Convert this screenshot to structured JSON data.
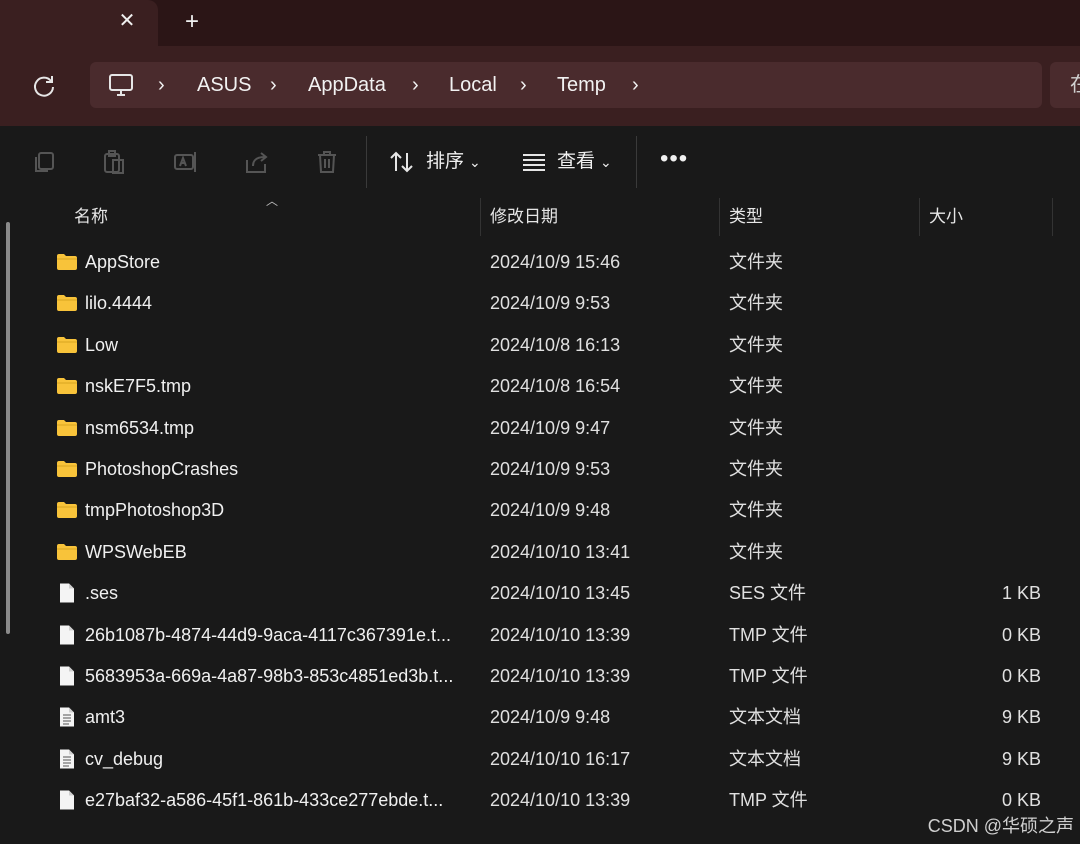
{
  "tabbar": {
    "close_glyph": "✕",
    "new_tab_glyph": "+"
  },
  "address": {
    "crumbs": [
      "ASUS",
      "AppData",
      "Local",
      "Temp"
    ],
    "separator": "›",
    "search_partial": "在"
  },
  "toolbar": {
    "sort_label": "排序",
    "view_label": "查看",
    "more_glyph": "•••",
    "dropdown_glyph": "⌄"
  },
  "columns": {
    "name": "名称",
    "modified": "修改日期",
    "type": "类型",
    "size": "大小"
  },
  "files": [
    {
      "name": "AppStore",
      "date": "2024/10/9 15:46",
      "type": "文件夹",
      "size": "",
      "kind": "folder"
    },
    {
      "name": "lilo.4444",
      "date": "2024/10/9 9:53",
      "type": "文件夹",
      "size": "",
      "kind": "folder"
    },
    {
      "name": "Low",
      "date": "2024/10/8 16:13",
      "type": "文件夹",
      "size": "",
      "kind": "folder"
    },
    {
      "name": "nskE7F5.tmp",
      "date": "2024/10/8 16:54",
      "type": "文件夹",
      "size": "",
      "kind": "folder"
    },
    {
      "name": "nsm6534.tmp",
      "date": "2024/10/9 9:47",
      "type": "文件夹",
      "size": "",
      "kind": "folder"
    },
    {
      "name": "PhotoshopCrashes",
      "date": "2024/10/9 9:53",
      "type": "文件夹",
      "size": "",
      "kind": "folder"
    },
    {
      "name": "tmpPhotoshop3D",
      "date": "2024/10/9 9:48",
      "type": "文件夹",
      "size": "",
      "kind": "folder"
    },
    {
      "name": "WPSWebEB",
      "date": "2024/10/10 13:41",
      "type": "文件夹",
      "size": "",
      "kind": "folder"
    },
    {
      "name": ".ses",
      "date": "2024/10/10 13:45",
      "type": "SES 文件",
      "size": "1 KB",
      "kind": "file"
    },
    {
      "name": "26b1087b-4874-44d9-9aca-4117c367391e.t...",
      "date": "2024/10/10 13:39",
      "type": "TMP 文件",
      "size": "0 KB",
      "kind": "file"
    },
    {
      "name": "5683953a-669a-4a87-98b3-853c4851ed3b.t...",
      "date": "2024/10/10 13:39",
      "type": "TMP 文件",
      "size": "0 KB",
      "kind": "file"
    },
    {
      "name": "amt3",
      "date": "2024/10/9 9:48",
      "type": "文本文档",
      "size": "9 KB",
      "kind": "text"
    },
    {
      "name": "cv_debug",
      "date": "2024/10/10 16:17",
      "type": "文本文档",
      "size": "9 KB",
      "kind": "text"
    },
    {
      "name": "e27baf32-a586-45f1-861b-433ce277ebde.t...",
      "date": "2024/10/10 13:39",
      "type": "TMP 文件",
      "size": "0 KB",
      "kind": "file"
    }
  ],
  "watermark": "CSDN @华硕之声",
  "colors": {
    "titlebar": "#2b1516",
    "navbar": "#3a1f20",
    "address_bg": "#4a2b2d",
    "list_bg": "#191919",
    "folder_yellow": "#f8c33a"
  }
}
